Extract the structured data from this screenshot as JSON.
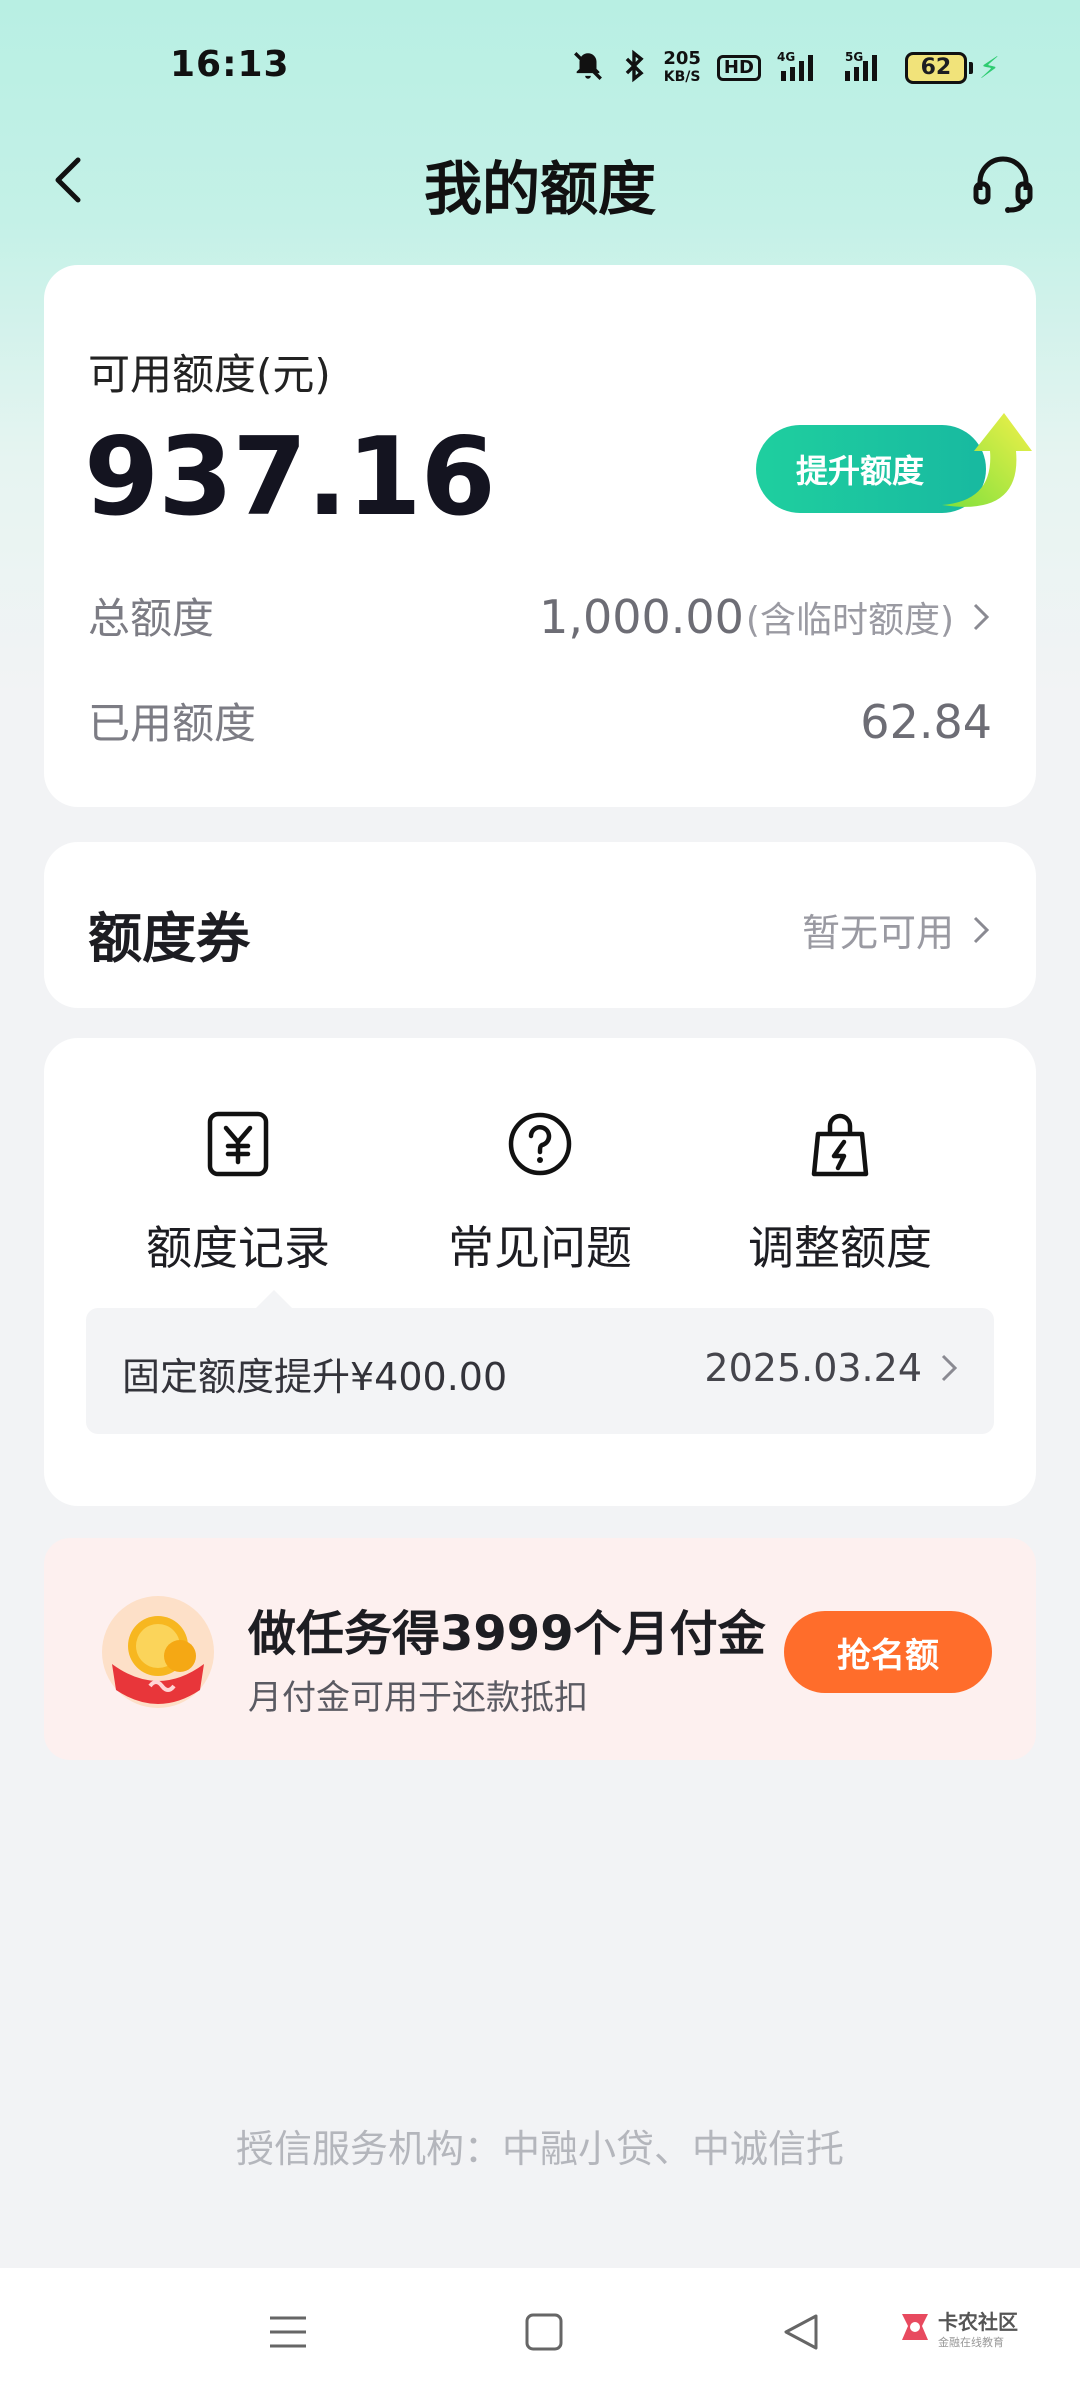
{
  "status_bar": {
    "time": "16:13",
    "net_speed_value": "205",
    "net_speed_unit": "KB/S",
    "hd_label": "HD",
    "signal_4g": "4G",
    "signal_5g": "5G",
    "battery_level": "62",
    "icons": [
      "mute-bell-icon",
      "bluetooth-icon",
      "hd-icon",
      "signal-4g-icon",
      "signal-5g-icon",
      "battery-icon",
      "charging-icon"
    ]
  },
  "nav": {
    "title": "我的额度",
    "back_icon": "chevron-left-icon",
    "service_icon": "headset-icon"
  },
  "quota": {
    "available_label": "可用额度(元)",
    "available_amount": "937.16",
    "raise_button": "提升额度",
    "total_label": "总额度",
    "total_value": "1,000.00",
    "total_note": "(含临时额度)",
    "used_label": "已用额度",
    "used_value": "62.84"
  },
  "coupon": {
    "label": "额度券",
    "status": "暂无可用"
  },
  "shortcuts": [
    {
      "label": "额度记录",
      "icon": "yuan-receipt-icon"
    },
    {
      "label": "常见问题",
      "icon": "question-circle-icon"
    },
    {
      "label": "调整额度",
      "icon": "lightning-bag-icon"
    }
  ],
  "record": {
    "text": "固定额度提升¥400.00",
    "date": "2025.03.24"
  },
  "promo": {
    "title": "做任务得3999个月付金",
    "subtitle": "月付金可用于还款抵扣",
    "button": "抢名额",
    "icon": "gold-coin-icon"
  },
  "footer": {
    "note": "授信服务机构：中融小贷、中诚信托"
  },
  "system_nav": {
    "icons": [
      "menu-icon",
      "home-square-icon",
      "back-triangle-icon"
    ],
    "watermark_title": "卡农社区",
    "watermark_sub": "金融在线教育"
  },
  "colors": {
    "accent_green": "#1fcf9f",
    "promo_orange": "#ff6d2b",
    "promo_bg": "#fdf0ef",
    "header_mint": "#b8efe3"
  }
}
